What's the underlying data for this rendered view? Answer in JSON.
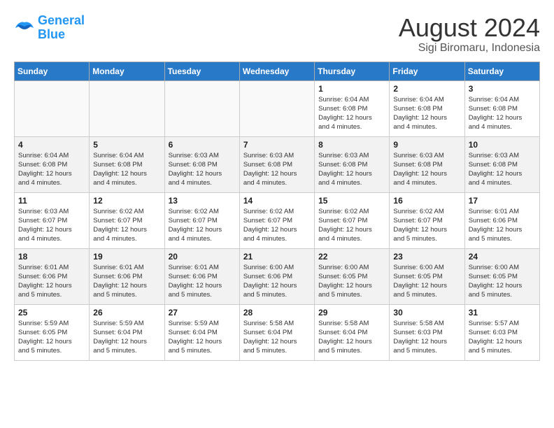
{
  "header": {
    "logo_line1": "General",
    "logo_line2": "Blue",
    "month_year": "August 2024",
    "location": "Sigi Biromaru, Indonesia"
  },
  "weekdays": [
    "Sunday",
    "Monday",
    "Tuesday",
    "Wednesday",
    "Thursday",
    "Friday",
    "Saturday"
  ],
  "weeks": [
    [
      {
        "day": "",
        "info": ""
      },
      {
        "day": "",
        "info": ""
      },
      {
        "day": "",
        "info": ""
      },
      {
        "day": "",
        "info": ""
      },
      {
        "day": "1",
        "info": "Sunrise: 6:04 AM\nSunset: 6:08 PM\nDaylight: 12 hours\nand 4 minutes."
      },
      {
        "day": "2",
        "info": "Sunrise: 6:04 AM\nSunset: 6:08 PM\nDaylight: 12 hours\nand 4 minutes."
      },
      {
        "day": "3",
        "info": "Sunrise: 6:04 AM\nSunset: 6:08 PM\nDaylight: 12 hours\nand 4 minutes."
      }
    ],
    [
      {
        "day": "4",
        "info": "Sunrise: 6:04 AM\nSunset: 6:08 PM\nDaylight: 12 hours\nand 4 minutes."
      },
      {
        "day": "5",
        "info": "Sunrise: 6:04 AM\nSunset: 6:08 PM\nDaylight: 12 hours\nand 4 minutes."
      },
      {
        "day": "6",
        "info": "Sunrise: 6:03 AM\nSunset: 6:08 PM\nDaylight: 12 hours\nand 4 minutes."
      },
      {
        "day": "7",
        "info": "Sunrise: 6:03 AM\nSunset: 6:08 PM\nDaylight: 12 hours\nand 4 minutes."
      },
      {
        "day": "8",
        "info": "Sunrise: 6:03 AM\nSunset: 6:08 PM\nDaylight: 12 hours\nand 4 minutes."
      },
      {
        "day": "9",
        "info": "Sunrise: 6:03 AM\nSunset: 6:08 PM\nDaylight: 12 hours\nand 4 minutes."
      },
      {
        "day": "10",
        "info": "Sunrise: 6:03 AM\nSunset: 6:08 PM\nDaylight: 12 hours\nand 4 minutes."
      }
    ],
    [
      {
        "day": "11",
        "info": "Sunrise: 6:03 AM\nSunset: 6:07 PM\nDaylight: 12 hours\nand 4 minutes."
      },
      {
        "day": "12",
        "info": "Sunrise: 6:02 AM\nSunset: 6:07 PM\nDaylight: 12 hours\nand 4 minutes."
      },
      {
        "day": "13",
        "info": "Sunrise: 6:02 AM\nSunset: 6:07 PM\nDaylight: 12 hours\nand 4 minutes."
      },
      {
        "day": "14",
        "info": "Sunrise: 6:02 AM\nSunset: 6:07 PM\nDaylight: 12 hours\nand 4 minutes."
      },
      {
        "day": "15",
        "info": "Sunrise: 6:02 AM\nSunset: 6:07 PM\nDaylight: 12 hours\nand 4 minutes."
      },
      {
        "day": "16",
        "info": "Sunrise: 6:02 AM\nSunset: 6:07 PM\nDaylight: 12 hours\nand 5 minutes."
      },
      {
        "day": "17",
        "info": "Sunrise: 6:01 AM\nSunset: 6:06 PM\nDaylight: 12 hours\nand 5 minutes."
      }
    ],
    [
      {
        "day": "18",
        "info": "Sunrise: 6:01 AM\nSunset: 6:06 PM\nDaylight: 12 hours\nand 5 minutes."
      },
      {
        "day": "19",
        "info": "Sunrise: 6:01 AM\nSunset: 6:06 PM\nDaylight: 12 hours\nand 5 minutes."
      },
      {
        "day": "20",
        "info": "Sunrise: 6:01 AM\nSunset: 6:06 PM\nDaylight: 12 hours\nand 5 minutes."
      },
      {
        "day": "21",
        "info": "Sunrise: 6:00 AM\nSunset: 6:06 PM\nDaylight: 12 hours\nand 5 minutes."
      },
      {
        "day": "22",
        "info": "Sunrise: 6:00 AM\nSunset: 6:05 PM\nDaylight: 12 hours\nand 5 minutes."
      },
      {
        "day": "23",
        "info": "Sunrise: 6:00 AM\nSunset: 6:05 PM\nDaylight: 12 hours\nand 5 minutes."
      },
      {
        "day": "24",
        "info": "Sunrise: 6:00 AM\nSunset: 6:05 PM\nDaylight: 12 hours\nand 5 minutes."
      }
    ],
    [
      {
        "day": "25",
        "info": "Sunrise: 5:59 AM\nSunset: 6:05 PM\nDaylight: 12 hours\nand 5 minutes."
      },
      {
        "day": "26",
        "info": "Sunrise: 5:59 AM\nSunset: 6:04 PM\nDaylight: 12 hours\nand 5 minutes."
      },
      {
        "day": "27",
        "info": "Sunrise: 5:59 AM\nSunset: 6:04 PM\nDaylight: 12 hours\nand 5 minutes."
      },
      {
        "day": "28",
        "info": "Sunrise: 5:58 AM\nSunset: 6:04 PM\nDaylight: 12 hours\nand 5 minutes."
      },
      {
        "day": "29",
        "info": "Sunrise: 5:58 AM\nSunset: 6:04 PM\nDaylight: 12 hours\nand 5 minutes."
      },
      {
        "day": "30",
        "info": "Sunrise: 5:58 AM\nSunset: 6:03 PM\nDaylight: 12 hours\nand 5 minutes."
      },
      {
        "day": "31",
        "info": "Sunrise: 5:57 AM\nSunset: 6:03 PM\nDaylight: 12 hours\nand 5 minutes."
      }
    ]
  ]
}
